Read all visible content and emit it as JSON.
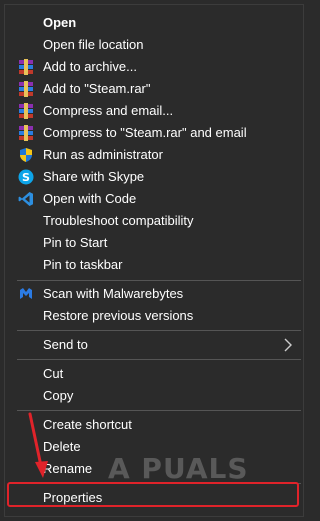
{
  "menu": {
    "items": [
      {
        "label": "Open",
        "icon": ""
      },
      {
        "label": "Open file location",
        "icon": ""
      },
      {
        "label": "Add to archive...",
        "icon": "winrar-icon"
      },
      {
        "label": "Add to \"Steam.rar\"",
        "icon": "winrar-icon"
      },
      {
        "label": "Compress and email...",
        "icon": "winrar-icon"
      },
      {
        "label": "Compress to \"Steam.rar\" and email",
        "icon": "winrar-icon"
      },
      {
        "label": "Run as administrator",
        "icon": "uac-shield-icon"
      },
      {
        "label": "Share with Skype",
        "icon": "skype-icon"
      },
      {
        "label": "Open with Code",
        "icon": "vscode-icon"
      },
      {
        "label": "Troubleshoot compatibility",
        "icon": ""
      },
      {
        "label": "Pin to Start",
        "icon": ""
      },
      {
        "label": "Pin to taskbar",
        "icon": ""
      },
      {
        "label": "Scan with Malwarebytes",
        "icon": "malwarebytes-icon"
      },
      {
        "label": "Restore previous versions",
        "icon": ""
      },
      {
        "label": "Send to",
        "icon": "chevron-right-icon"
      },
      {
        "label": "Cut",
        "icon": ""
      },
      {
        "label": "Copy",
        "icon": ""
      },
      {
        "label": "Create shortcut",
        "icon": ""
      },
      {
        "label": "Delete",
        "icon": ""
      },
      {
        "label": "Rename",
        "icon": ""
      },
      {
        "label": "Properties",
        "icon": ""
      }
    ]
  },
  "watermark": {
    "text": "A PUALS"
  },
  "colors": {
    "background": "#2b2b2b",
    "text": "#ffffff",
    "separator": "#555555",
    "highlight": "#e0232a"
  }
}
